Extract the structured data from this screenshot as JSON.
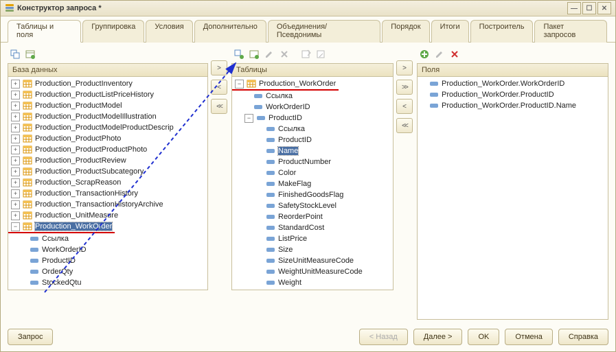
{
  "window": {
    "title": "Конструктор запроса *"
  },
  "tabs": [
    {
      "label": "Таблицы и поля",
      "active": true
    },
    {
      "label": "Группировка"
    },
    {
      "label": "Условия"
    },
    {
      "label": "Дополнительно"
    },
    {
      "label": "Объединения/Псевдонимы"
    },
    {
      "label": "Порядок"
    },
    {
      "label": "Итоги"
    },
    {
      "label": "Построитель"
    },
    {
      "label": "Пакет запросов"
    }
  ],
  "panel_db": {
    "title": "База данных",
    "items": [
      {
        "label": "Production_ProductInventory",
        "icon": "table",
        "exp": "+"
      },
      {
        "label": "Production_ProductListPriceHistory",
        "icon": "table",
        "exp": "+"
      },
      {
        "label": "Production_ProductModel",
        "icon": "table",
        "exp": "+"
      },
      {
        "label": "Production_ProductModelIllustration",
        "icon": "table",
        "exp": "+"
      },
      {
        "label": "Production_ProductModelProductDescrip",
        "icon": "table",
        "exp": "+"
      },
      {
        "label": "Production_ProductPhoto",
        "icon": "table",
        "exp": "+"
      },
      {
        "label": "Production_ProductProductPhoto",
        "icon": "table",
        "exp": "+"
      },
      {
        "label": "Production_ProductReview",
        "icon": "table",
        "exp": "+"
      },
      {
        "label": "Production_ProductSubcategory",
        "icon": "table",
        "exp": "+"
      },
      {
        "label": "Production_ScrapReason",
        "icon": "table",
        "exp": "+"
      },
      {
        "label": "Production_TransactionHistory",
        "icon": "table",
        "exp": "+"
      },
      {
        "label": "Production_TransactionHistoryArchive",
        "icon": "table",
        "exp": "+"
      },
      {
        "label": "Production_UnitMeasure",
        "icon": "table",
        "exp": "+"
      },
      {
        "label": "Production_WorkOrder",
        "icon": "table",
        "exp": "−",
        "selected": true,
        "underline": true
      }
    ],
    "children": [
      {
        "label": "Ссылка",
        "icon": "field"
      },
      {
        "label": "WorkOrderID",
        "icon": "field"
      },
      {
        "label": "ProductID",
        "icon": "field"
      },
      {
        "label": "OrderQty",
        "icon": "field"
      },
      {
        "label": "StockedQtu",
        "icon": "field"
      }
    ]
  },
  "panel_tables": {
    "title": "Таблицы",
    "root": {
      "label": "Production_WorkOrder",
      "icon": "table",
      "exp": "−",
      "underline": true
    },
    "child1": [
      {
        "label": "Ссылка",
        "icon": "field"
      },
      {
        "label": "WorkOrderID",
        "icon": "field"
      }
    ],
    "productid": {
      "label": "ProductID",
      "icon": "field",
      "exp": "−"
    },
    "child2": [
      {
        "label": "Ссылка",
        "icon": "field"
      },
      {
        "label": "ProductID",
        "icon": "field"
      },
      {
        "label": "Name",
        "icon": "field",
        "selected": true
      },
      {
        "label": "ProductNumber",
        "icon": "field"
      },
      {
        "label": "Color",
        "icon": "field"
      },
      {
        "label": "MakeFlag",
        "icon": "field"
      },
      {
        "label": "FinishedGoodsFlag",
        "icon": "field"
      },
      {
        "label": "SafetyStockLevel",
        "icon": "field"
      },
      {
        "label": "ReorderPoint",
        "icon": "field"
      },
      {
        "label": "StandardCost",
        "icon": "field"
      },
      {
        "label": "ListPrice",
        "icon": "field"
      },
      {
        "label": "Size",
        "icon": "field"
      },
      {
        "label": "SizeUnitMeasureCode",
        "icon": "field"
      },
      {
        "label": "WeightUnitMeasureCode",
        "icon": "field"
      },
      {
        "label": "Weight",
        "icon": "field"
      }
    ]
  },
  "panel_fields": {
    "title": "Поля",
    "items": [
      {
        "label": "Production_WorkOrder.WorkOrderID",
        "icon": "field"
      },
      {
        "label": "Production_WorkOrder.ProductID",
        "icon": "field"
      },
      {
        "label": "Production_WorkOrder.ProductID.Name",
        "icon": "field"
      }
    ]
  },
  "buttons": {
    "query": "Запрос",
    "back": "< Назад",
    "next": "Далее >",
    "ok": "OK",
    "cancel": "Отмена",
    "help": "Справка"
  }
}
